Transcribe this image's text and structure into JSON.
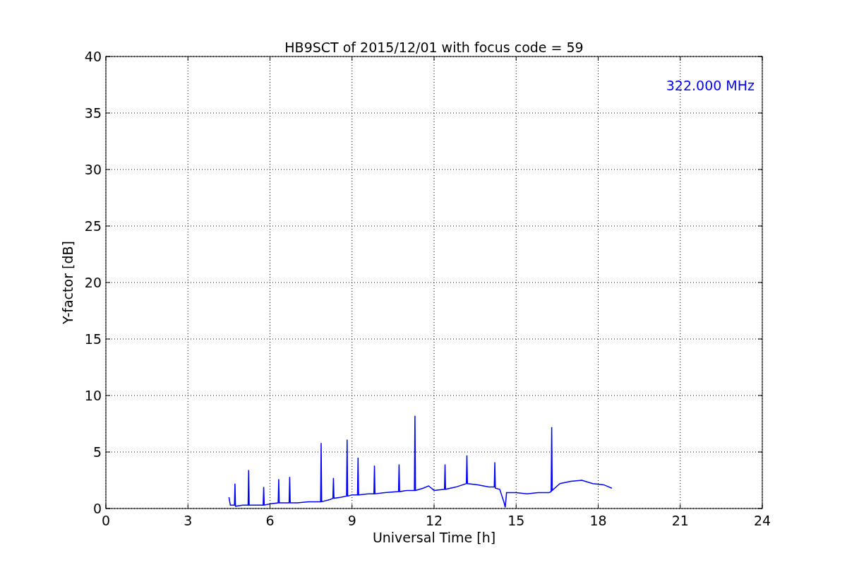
{
  "chart_data": {
    "type": "line",
    "title": "HB9SCT of 2015/12/01 with focus code = 59",
    "xlabel": "Universal Time [h]",
    "ylabel": "Y-factor [dB]",
    "x": [
      4.5,
      4.55,
      4.7,
      4.72,
      4.74,
      5.0,
      5.2,
      5.22,
      5.24,
      5.5,
      5.75,
      5.77,
      5.79,
      6.0,
      6.3,
      6.32,
      6.34,
      6.7,
      6.72,
      6.74,
      7.0,
      7.4,
      7.6,
      7.85,
      7.87,
      7.89,
      8.2,
      8.3,
      8.32,
      8.34,
      8.6,
      8.8,
      8.82,
      8.84,
      9.0,
      9.2,
      9.22,
      9.24,
      9.6,
      9.8,
      9.82,
      9.84,
      10.2,
      10.7,
      10.72,
      10.74,
      11.0,
      11.28,
      11.3,
      11.32,
      11.6,
      11.8,
      12.0,
      12.38,
      12.4,
      12.42,
      12.8,
      13.18,
      13.2,
      13.22,
      13.6,
      14.0,
      14.2,
      14.22,
      14.24,
      14.4,
      14.55,
      14.6,
      14.65,
      14.8,
      15.0,
      15.4,
      15.8,
      16.2,
      16.28,
      16.3,
      16.32,
      16.6,
      17.0,
      17.4,
      17.8,
      18.2,
      18.5
    ],
    "series": [
      {
        "name": "322.000 MHz",
        "color": "#0000ff",
        "values": [
          1.0,
          0.3,
          0.3,
          2.2,
          0.2,
          0.3,
          0.3,
          3.4,
          0.3,
          0.3,
          0.3,
          1.9,
          0.3,
          0.4,
          0.5,
          2.6,
          0.5,
          0.5,
          2.8,
          0.5,
          0.5,
          0.6,
          0.6,
          0.6,
          5.8,
          0.6,
          0.8,
          0.9,
          2.7,
          0.9,
          1.0,
          1.1,
          6.1,
          1.1,
          1.2,
          1.2,
          4.5,
          1.2,
          1.3,
          1.3,
          3.8,
          1.3,
          1.4,
          1.5,
          3.9,
          1.5,
          1.6,
          1.6,
          8.2,
          1.6,
          1.8,
          2.0,
          1.6,
          1.7,
          3.9,
          1.7,
          1.9,
          2.2,
          4.7,
          2.2,
          2.1,
          1.9,
          1.9,
          4.1,
          1.8,
          1.7,
          0.6,
          0.1,
          1.4,
          1.4,
          1.4,
          1.3,
          1.4,
          1.4,
          1.5,
          7.2,
          1.6,
          2.2,
          2.4,
          2.5,
          2.2,
          2.1,
          1.8
        ]
      }
    ],
    "xlim": [
      0,
      24
    ],
    "ylim": [
      0,
      40
    ],
    "xticks": [
      0,
      3,
      6,
      9,
      12,
      15,
      18,
      21,
      24
    ],
    "yticks": [
      0,
      5,
      10,
      15,
      20,
      25,
      30,
      35,
      40
    ],
    "grid": true
  }
}
